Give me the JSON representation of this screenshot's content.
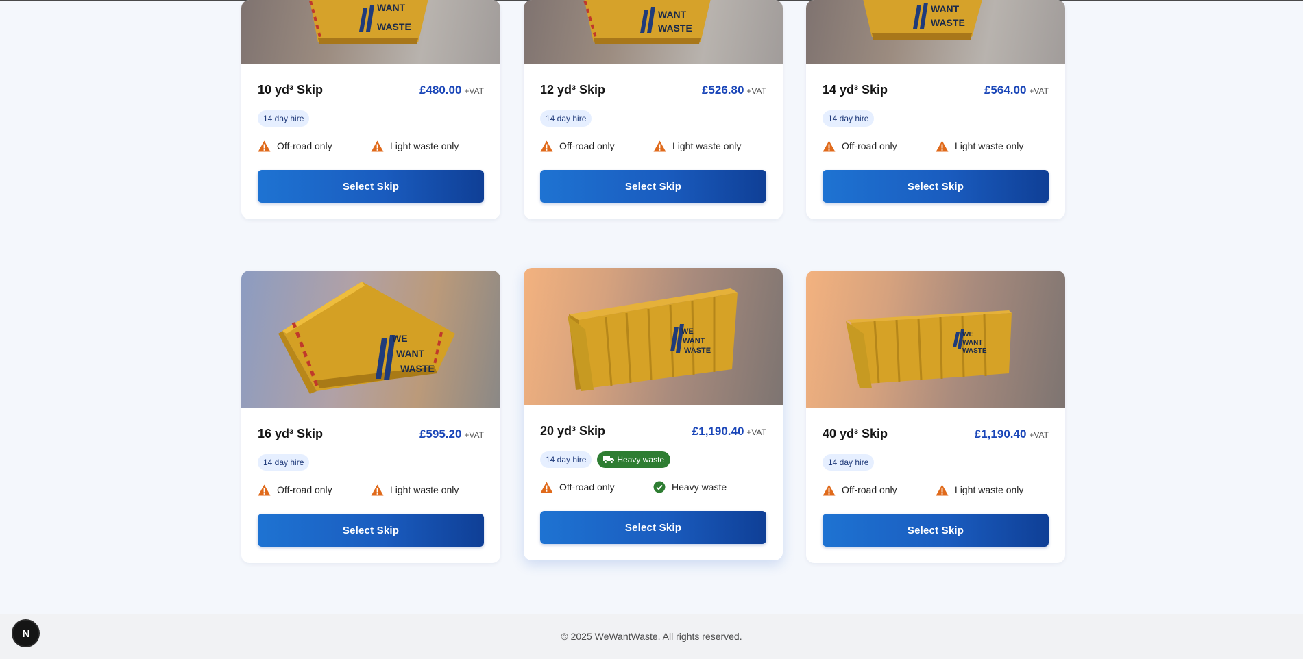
{
  "colors": {
    "accent": "#1a46b8",
    "button": "#1a5cbf",
    "warning": "#e06a1b",
    "success": "#2e7d32"
  },
  "cards": [
    {
      "title": "10 yd³ Skip",
      "price": "£480.00",
      "vat": "+VAT",
      "hire": "14 day hire",
      "feature1": "Off-road only",
      "feature2": "Light waste only",
      "feature2_icon": "warning-icon",
      "button": "Select Skip"
    },
    {
      "title": "12 yd³ Skip",
      "price": "£526.80",
      "vat": "+VAT",
      "hire": "14 day hire",
      "feature1": "Off-road only",
      "feature2": "Light waste only",
      "feature2_icon": "warning-icon",
      "button": "Select Skip"
    },
    {
      "title": "14 yd³ Skip",
      "price": "£564.00",
      "vat": "+VAT",
      "hire": "14 day hire",
      "feature1": "Off-road only",
      "feature2": "Light waste only",
      "feature2_icon": "warning-icon",
      "button": "Select Skip"
    },
    {
      "title": "16 yd³ Skip",
      "price": "£595.20",
      "vat": "+VAT",
      "hire": "14 day hire",
      "feature1": "Off-road only",
      "feature2": "Light waste only",
      "feature2_icon": "warning-icon",
      "button": "Select Skip"
    },
    {
      "title": "20 yd³ Skip",
      "price": "£1,190.40",
      "vat": "+VAT",
      "hire": "14 day hire",
      "heavy_tag": "Heavy waste",
      "feature1": "Off-road only",
      "feature2": "Heavy waste",
      "feature2_icon": "check-circle-icon",
      "button": "Select Skip"
    },
    {
      "title": "40 yd³ Skip",
      "price": "£1,190.40",
      "vat": "+VAT",
      "hire": "14 day hire",
      "feature1": "Off-road only",
      "feature2": "Light waste only",
      "feature2_icon": "warning-icon",
      "button": "Select Skip"
    }
  ],
  "skip_logo": [
    "WE",
    "WANT",
    "WASTE"
  ],
  "footer": {
    "text": "© 2025 WeWantWaste. All rights reserved."
  },
  "dev_badge": {
    "letter": "N"
  }
}
